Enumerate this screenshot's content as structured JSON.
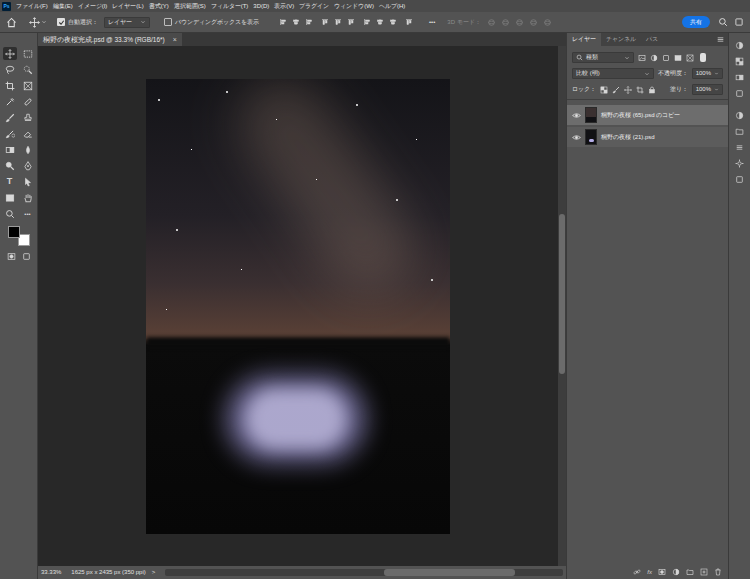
{
  "menu_bar": {
    "app_icon": "Ps",
    "items": [
      "ファイル(F)",
      "編集(E)",
      "イメージ(I)",
      "レイヤー(L)",
      "書式(Y)",
      "選択範囲(S)",
      "フィルター(T)",
      "3D(D)",
      "表示(V)",
      "プラグイン",
      "ウィンドウ(W)",
      "ヘルプ(H)"
    ]
  },
  "options_bar": {
    "auto_select": {
      "label": "自動選択：",
      "checked": true
    },
    "target": "レイヤー",
    "bounding_box": {
      "label": "バウンディングボックスを表示",
      "checked": false
    },
    "more": "•••",
    "mode_3d": {
      "label": "3D モード：",
      "disabled": true
    },
    "share": "共有"
  },
  "document_tab": {
    "title": "桐野の夜桜完成.psd @ 33.3% (RGB/16*)",
    "close": "×",
    "selected": true
  },
  "toolbar": {
    "tools": [
      {
        "selected": true
      },
      {
        "selected": false
      },
      {
        "selected": false
      },
      {
        "selected": false
      },
      {
        "selected": false
      },
      {
        "selected": false
      },
      {
        "selected": false
      },
      {
        "selected": false
      },
      {
        "selected": false
      },
      {
        "selected": false
      },
      {
        "selected": false
      },
      {
        "selected": false
      },
      {
        "selected": false
      },
      {
        "selected": false
      },
      {
        "selected": false
      },
      {
        "selected": false
      },
      {
        "glyph": "T",
        "selected": false
      },
      {
        "selected": false
      },
      {
        "selected": false
      },
      {
        "selected": false
      },
      {
        "selected": false
      },
      {
        "glyph": "•••",
        "selected": false
      }
    ]
  },
  "layers_panel": {
    "tabs": [
      {
        "label": "レイヤー",
        "selected": true
      },
      {
        "label": "チャンネル",
        "selected": false
      },
      {
        "label": "パス",
        "selected": false
      }
    ],
    "filter": "種類",
    "blend_mode": "比較 (明)",
    "opacity_label": "不透明度：",
    "opacity": "100%",
    "lock_label": "ロック：",
    "fill_label": "塗り：",
    "fill": "100%",
    "layers": [
      {
        "name": "桐野の夜桜 (65).psd のコピー",
        "visible": true,
        "selected": true
      },
      {
        "name": "桐野の夜桜 (21).psd",
        "visible": true,
        "selected": false
      }
    ],
    "fx_label": "fx"
  },
  "status_bar": {
    "zoom": "33.33%",
    "info": "1625 px x 2435 px (350 ppi)",
    "arrow": ">"
  }
}
